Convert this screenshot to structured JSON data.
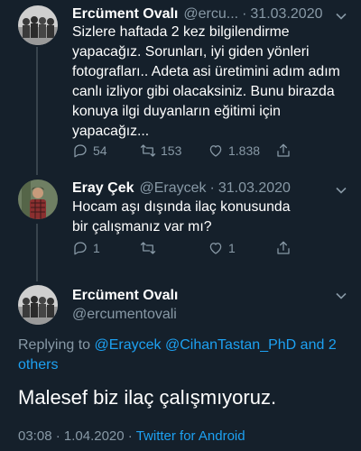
{
  "tweet1": {
    "name": "Ercüment Ovalı",
    "handle": "@ercu...",
    "date": "31.03.2020",
    "text": "Sizlere haftada 2 kez bilgilendirme yapacağız. Sorunları, iyi giden yönleri fotografları.. Adeta asi üretimini adım adım canlı izliyor gibi olacaksiniz. Bunu birazda konuya ilgi duyanların eğitimi için yapacağız...",
    "replies": "54",
    "retweets": "153",
    "likes": "1.838"
  },
  "tweet2": {
    "name": "Eray Çek",
    "handle": "@Eraycek",
    "date": "31.03.2020",
    "text": "Hocam aşı dışında ilaç konusunda bir çalışmanız var mı?",
    "replies": "1",
    "retweets": "",
    "likes": "1"
  },
  "focused_tweet": {
    "name": "Ercüment Ovalı",
    "handle": "@ercumentovali",
    "replying_prefix": "Replying to",
    "mention_1": "@Eraycek",
    "mention_2": "@CihanTastan_PhD",
    "replying_suffix": "and 2 others",
    "text": "Malesef biz ilaç çalışmıyoruz.",
    "time": "03:08",
    "date": "1.04.2020",
    "source": "Twitter for Android"
  },
  "icons": {
    "reply": "reply-icon",
    "retweet": "retweet-icon",
    "like": "heart-icon",
    "share": "share-icon",
    "menu": "chevron-down-icon"
  },
  "colors": {
    "background": "#15202b",
    "secondary_text": "#8899a6",
    "link": "#1da1f2",
    "divider": "#38444d"
  }
}
